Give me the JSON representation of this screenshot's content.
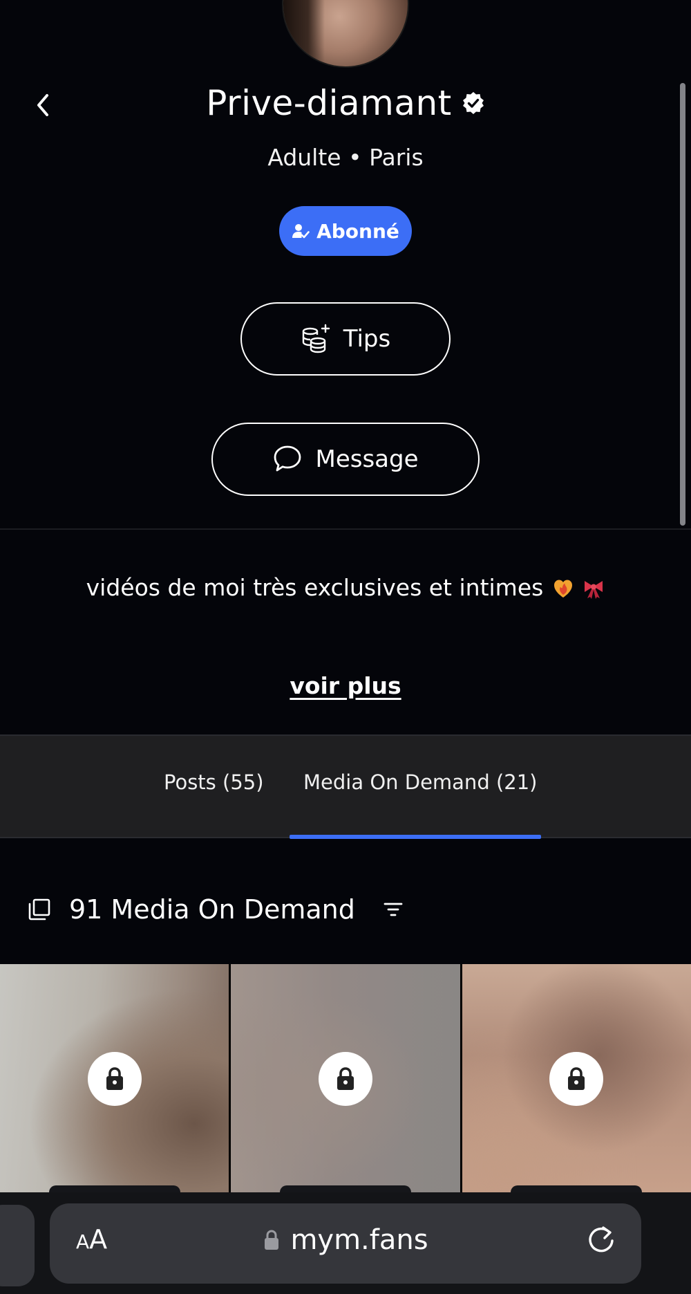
{
  "profile": {
    "name": "Prive-diamant",
    "category": "Adulte",
    "separator": "•",
    "location": "Paris",
    "subscribed_label": "Abonné",
    "tips_label": "Tips",
    "message_label": "Message",
    "bio": "vidéos de moi très exclusives et intimes",
    "bio_emojis": [
      "fire-heart",
      "ribbon"
    ],
    "see_more_label": "voir plus"
  },
  "tabs": [
    {
      "label": "Posts (55)",
      "active": false
    },
    {
      "label": "Media On Demand (21)",
      "active": true
    }
  ],
  "media_section": {
    "title": "91 Media On Demand"
  },
  "media_grid": [
    {
      "locked": true
    },
    {
      "locked": true
    },
    {
      "locked": true
    }
  ],
  "browser": {
    "text_size_small": "A",
    "text_size_large": "A",
    "url": "mym.fans"
  },
  "colors": {
    "accent": "#3c6ef6",
    "background": "#04050a",
    "tab_bar": "#1f1f21"
  }
}
